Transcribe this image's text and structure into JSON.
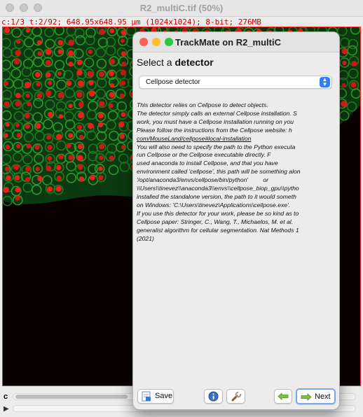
{
  "image_window": {
    "title": "R2_multiC.tif (50%)",
    "info": "c:1/3 t:2/92; 648.95x648.95 µm (1024x1024); 8-bit; 276MB",
    "channel_label": "c"
  },
  "dialog": {
    "title": "TrackMate on R2_multiC",
    "heading_prefix": "Select a ",
    "heading_bold": "detector",
    "detector_selected": "Cellpose detector",
    "description_lines": [
      "This detector relies on Cellpose to detect objects.",
      "The detector simply calls an external Cellpose installation. S",
      "work, you must have a Cellpose installation running on you",
      "Please follow the instructions from the Cellpose website: h",
      "com/MouseLand/cellpose#local-installation",
      "You will also need to specify the path to the Python executa",
      "run Cellpose or the Cellpose executable directly. F",
      "used anaconda to install Cellpose, and that you have",
      "environment called 'cellpose', this path will be something alon",
      "'/opt/anaconda3/envs/cellpose/bin/python'         or",
      "\\\\Users\\\\tinevez\\\\anaconda3\\\\envs\\\\cellpose_biop_gpu\\\\pytho",
      "installed the standalone version, the path to it would someth",
      "on Windows: 'C:\\Users\\tinevez\\Applications\\cellpose.exe'.",
      "If you use this detector for your work, please be so kind as to",
      "Cellpose paper: Stringer, C., Wang, T., Michaelos, M. et al.",
      "generalist algorithm for cellular segmentation. Nat Methods 1",
      "(2021)"
    ],
    "save_label": "Save",
    "next_label": "Next"
  },
  "colors": {
    "close": "#fe5f57",
    "minimize": "#febc2e",
    "zoom": "#28c840",
    "select_accent": "#2f7cf6",
    "info_text": "#d00000"
  }
}
